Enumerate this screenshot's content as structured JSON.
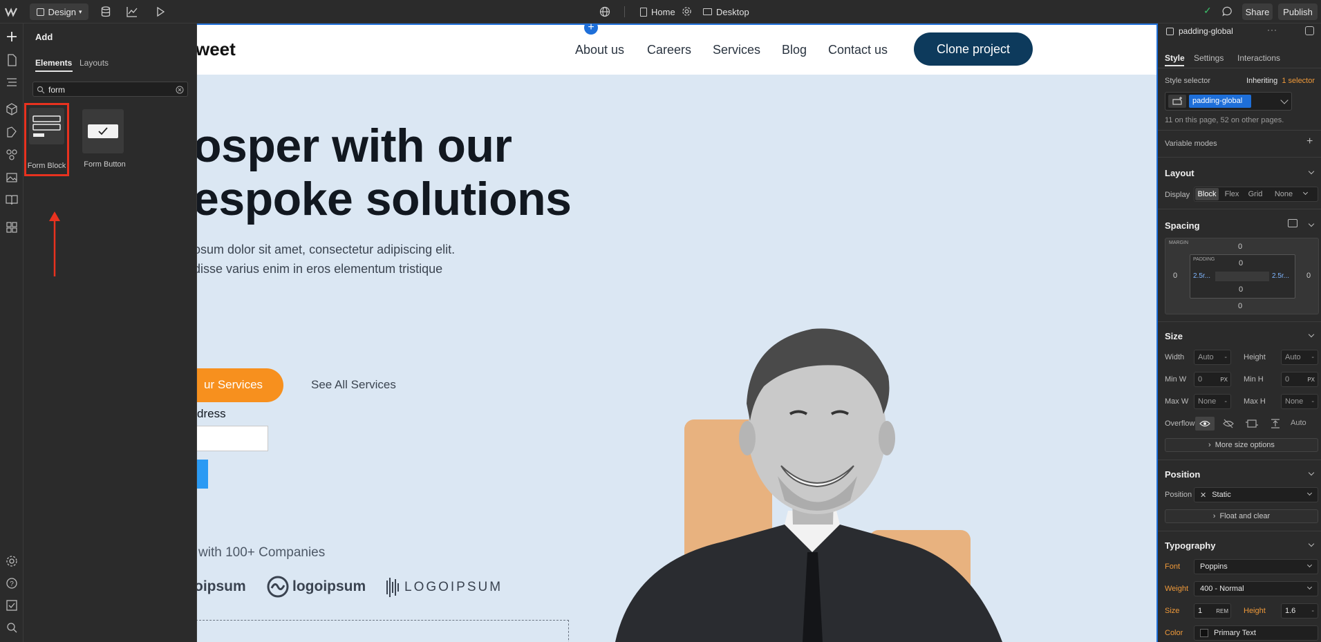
{
  "topbar": {
    "mode_label": "Design",
    "page_label": "Home",
    "breakpoint_label": "Desktop",
    "share_label": "Share",
    "publish_label": "Publish"
  },
  "add_panel": {
    "title": "Add",
    "tabs": [
      "Elements",
      "Layouts"
    ],
    "search_value": "form",
    "elements": [
      {
        "label": "Form Block",
        "icon": "form-block-icon"
      },
      {
        "label": "Form Button",
        "icon": "form-button-icon"
      }
    ]
  },
  "canvas": {
    "brand": "weet",
    "nav": [
      "About us",
      "Careers",
      "Services",
      "Blog",
      "Contact us"
    ],
    "cta": "Clone project",
    "hero_line1": "osper with our",
    "hero_line2": "espoke solutions",
    "para_line1": "osum dolor sit amet, consectetur adipiscing elit.",
    "para_line2": "disse varius enim in eros elementum tristique",
    "primary_btn": "ur Services",
    "secondary_btn": "See All Services",
    "form_label": "dress",
    "trusted": "with 100+ Companies",
    "logos": [
      "oipsum",
      "logoipsum",
      "LOGOIPSUM"
    ]
  },
  "right_panel": {
    "selector_name": "padding-global",
    "tabs": [
      "Style",
      "Settings",
      "Interactions"
    ],
    "style_selector_label": "Style selector",
    "inheriting_label": "Inheriting",
    "inheriting_count": "1 selector",
    "class_chip": "padding-global",
    "usage_note": "11 on this page, 52 on other pages.",
    "variable_modes": "Variable modes",
    "layout": {
      "title": "Layout",
      "display_label": "Display",
      "options": [
        "Block",
        "Flex",
        "Grid",
        "None"
      ]
    },
    "spacing": {
      "title": "Spacing",
      "margin_label": "MARGIN",
      "padding_label": "PADDING",
      "margin_top": "0",
      "margin_left": "0",
      "margin_right": "0",
      "margin_bottom": "0",
      "padding_top": "0",
      "padding_left": "2.5r...",
      "padding_right": "2.5r...",
      "padding_bottom": "0"
    },
    "size": {
      "title": "Size",
      "width_label": "Width",
      "width_value": "Auto",
      "height_label": "Height",
      "height_value": "Auto",
      "minw_label": "Min W",
      "minw_value": "0",
      "minw_unit": "PX",
      "minh_label": "Min H",
      "minh_value": "0",
      "minh_unit": "PX",
      "maxw_label": "Max W",
      "maxw_value": "None",
      "maxh_label": "Max H",
      "maxh_value": "None",
      "overflow_label": "Overflow",
      "overflow_auto": "Auto",
      "more_label": "More size options"
    },
    "position": {
      "title": "Position",
      "position_label": "Position",
      "position_value": "Static",
      "float_label": "Float and clear"
    },
    "typography": {
      "title": "Typography",
      "font_label": "Font",
      "font_value": "Poppins",
      "weight_label": "Weight",
      "weight_value": "400 - Normal",
      "size_label": "Size",
      "size_value": "1",
      "size_unit": "REM",
      "height_label": "Height",
      "height_value": "1.6",
      "color_label": "Color",
      "color_value": "Primary Text"
    }
  },
  "colors": {
    "accent_blue": "#1e6fd9",
    "highlight_red": "#e8321f",
    "brand_orange": "#f7901e",
    "nav_dark": "#0d3a5c"
  }
}
